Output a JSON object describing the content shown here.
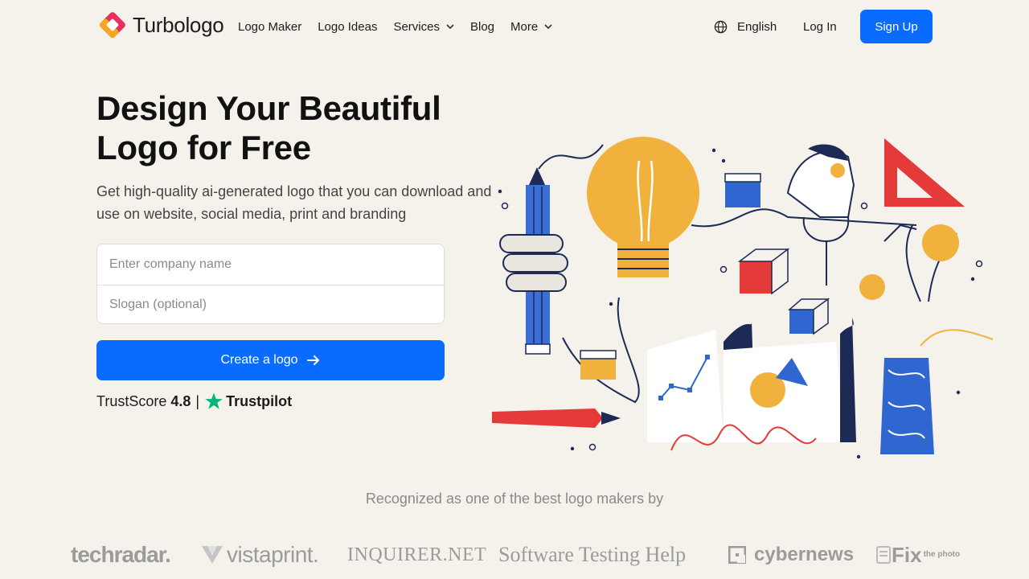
{
  "header": {
    "brand_name": "Turbologo",
    "nav": [
      {
        "label": "Logo Maker",
        "has_dropdown": false
      },
      {
        "label": "Logo Ideas",
        "has_dropdown": false
      },
      {
        "label": "Services",
        "has_dropdown": true
      },
      {
        "label": "Blog",
        "has_dropdown": false
      },
      {
        "label": "More",
        "has_dropdown": true
      }
    ],
    "language": "English",
    "login_label": "Log In",
    "signup_label": "Sign Up"
  },
  "hero": {
    "title_line1": "Design Your Beautiful",
    "title_line2": "Logo for Free",
    "subtitle": "Get high-quality ai-generated logo that you can download and use on website, social media, print and branding",
    "company_placeholder": "Enter company name",
    "slogan_placeholder": "Slogan (optional)",
    "cta_label": "Create a logo",
    "trust_prefix": "TrustScore",
    "trust_score": "4.8",
    "trust_separator": "|",
    "trust_brand": "Trustpilot"
  },
  "recognition": {
    "text": "Recognized as one of the best logo makers by",
    "brands": [
      "techradar.",
      "vistaprint.",
      "INQUIRER.NET",
      "Software Testing Help",
      "cybernews",
      "Fix",
      "the photo"
    ]
  },
  "colors": {
    "accent": "#0a6cff",
    "background": "#f5f2ec",
    "trustpilot_green": "#00b67a"
  }
}
